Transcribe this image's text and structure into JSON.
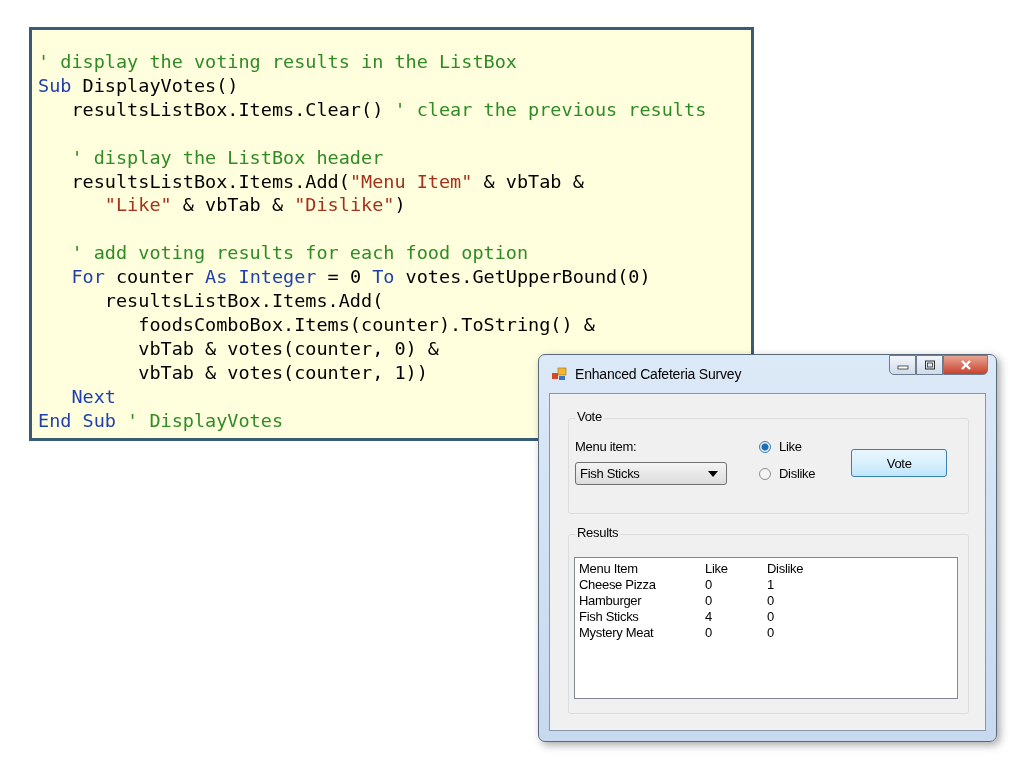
{
  "code_listing": {
    "blocks": [
      [
        {
          "tokens": [
            {
              "kind": "comment",
              "text": "' display the voting results in the ListBox"
            }
          ]
        },
        {
          "tokens": [
            {
              "kind": "keyword",
              "text": "Sub"
            },
            {
              "kind": "plain",
              "text": " DisplayVotes()"
            }
          ]
        },
        {
          "tokens": [
            {
              "kind": "plain",
              "text": "   resultsListBox.Items.Clear() "
            },
            {
              "kind": "comment",
              "text": "' clear the previous results"
            }
          ]
        }
      ],
      [
        {
          "tokens": [
            {
              "kind": "comment",
              "text": "   ' display the ListBox header"
            }
          ]
        },
        {
          "tokens": [
            {
              "kind": "plain",
              "text": "   resultsListBox.Items.Add("
            },
            {
              "kind": "string",
              "text": "\"Menu Item\""
            },
            {
              "kind": "plain",
              "text": " & vbTab &"
            }
          ]
        },
        {
          "tokens": [
            {
              "kind": "string",
              "text": "      \"Like\""
            },
            {
              "kind": "plain",
              "text": " & vbTab & "
            },
            {
              "kind": "string",
              "text": "\"Dislike\""
            },
            {
              "kind": "plain",
              "text": ")"
            }
          ]
        }
      ],
      [
        {
          "tokens": [
            {
              "kind": "comment",
              "text": "   ' add voting results for each food option"
            }
          ]
        },
        {
          "tokens": [
            {
              "kind": "keyword",
              "text": "   For"
            },
            {
              "kind": "plain",
              "text": " counter "
            },
            {
              "kind": "keyword",
              "text": "As Integer"
            },
            {
              "kind": "plain",
              "text": " = 0 "
            },
            {
              "kind": "keyword",
              "text": "To"
            },
            {
              "kind": "plain",
              "text": " votes.GetUpperBound(0)"
            }
          ]
        },
        {
          "tokens": [
            {
              "kind": "plain",
              "text": "      resultsListBox.Items.Add("
            }
          ]
        },
        {
          "tokens": [
            {
              "kind": "plain",
              "text": "         foodsComboBox.Items(counter).ToString() &"
            }
          ]
        },
        {
          "tokens": [
            {
              "kind": "plain",
              "text": "         vbTab & votes(counter, 0) &"
            }
          ]
        },
        {
          "tokens": [
            {
              "kind": "plain",
              "text": "         vbTab & votes(counter, 1))"
            }
          ]
        },
        {
          "tokens": [
            {
              "kind": "keyword",
              "text": "   Next"
            }
          ]
        },
        {
          "tokens": [
            {
              "kind": "keyword",
              "text": "End Sub"
            },
            {
              "kind": "comment",
              "text": " ' DisplayVotes"
            }
          ]
        }
      ]
    ]
  },
  "window": {
    "title": "Enhanced Cafeteria Survey",
    "vote_group": {
      "title": "Vote",
      "menu_label": "Menu item:",
      "menu_value": "Fish Sticks",
      "options": [
        {
          "label": "Like",
          "selected": true
        },
        {
          "label": "Dislike",
          "selected": false
        }
      ],
      "button": "Vote"
    },
    "results_group": {
      "title": "Results",
      "rows": [
        [
          "Menu Item",
          "Like",
          "Dislike"
        ],
        [
          "Cheese Pizza",
          "0",
          "1"
        ],
        [
          "Hamburger",
          "0",
          "0"
        ],
        [
          "Fish Sticks",
          "4",
          "0"
        ],
        [
          "Mystery Meat",
          "0",
          "0"
        ]
      ]
    }
  }
}
